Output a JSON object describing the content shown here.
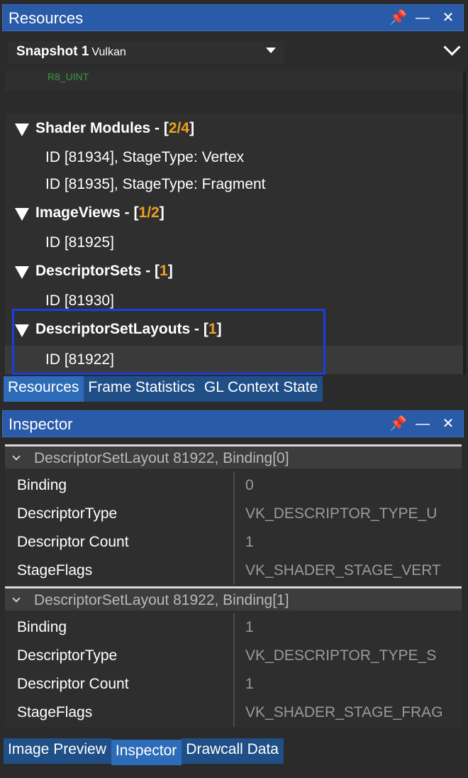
{
  "resources_panel": {
    "title": "Resources",
    "snapshot": {
      "title": "Snapshot 1",
      "api": "Vulkan"
    },
    "truncated_item": "R8_UINT",
    "nodes": [
      {
        "label": "Shader Modules - [",
        "count": "2/4",
        "suffix": "]",
        "children": [
          "ID [81934], StageType: Vertex",
          "ID [81935], StageType: Fragment"
        ]
      },
      {
        "label": "ImageViews - [",
        "count": "1/2",
        "suffix": "]",
        "children": [
          "ID [81925]"
        ]
      },
      {
        "label": "DescriptorSets - [",
        "count": "1",
        "suffix": "]",
        "children": [
          "ID [81930]"
        ]
      },
      {
        "label": "DescriptorSetLayouts - [",
        "count": "1",
        "suffix": "]",
        "children": [
          "ID [81922]"
        ]
      }
    ],
    "tabs": [
      "Resources",
      "Frame Statistics",
      "GL Context State"
    ],
    "active_tab": "Resources"
  },
  "inspector_panel": {
    "title": "Inspector",
    "groups": [
      {
        "header": "DescriptorSetLayout 81922, Binding[0]",
        "rows": [
          {
            "key": "Binding",
            "value": "0"
          },
          {
            "key": "DescriptorType",
            "value": "VK_DESCRIPTOR_TYPE_U"
          },
          {
            "key": "Descriptor Count",
            "value": "1"
          },
          {
            "key": "StageFlags",
            "value": "VK_SHADER_STAGE_VERT"
          }
        ]
      },
      {
        "header": "DescriptorSetLayout 81922, Binding[1]",
        "rows": [
          {
            "key": "Binding",
            "value": "1"
          },
          {
            "key": "DescriptorType",
            "value": "VK_DESCRIPTOR_TYPE_S"
          },
          {
            "key": "Descriptor Count",
            "value": "1"
          },
          {
            "key": "StageFlags",
            "value": "VK_SHADER_STAGE_FRAG"
          }
        ]
      }
    ],
    "tabs": [
      "Image Preview",
      "Inspector",
      "Drawcall Data"
    ],
    "active_tab": "Inspector"
  },
  "icons": [
    "pin-icon",
    "minimize-icon",
    "close-icon",
    "dropdown-arrow-icon",
    "chevron-down-icon",
    "expand-triangle-icon"
  ],
  "colors": {
    "title_bar": "#2a5ba8",
    "count_accent": "#f0a020",
    "selection_box": "#1a3de0",
    "tab_active": "#2d6cb8",
    "tab_inactive": "#1f4f86"
  }
}
